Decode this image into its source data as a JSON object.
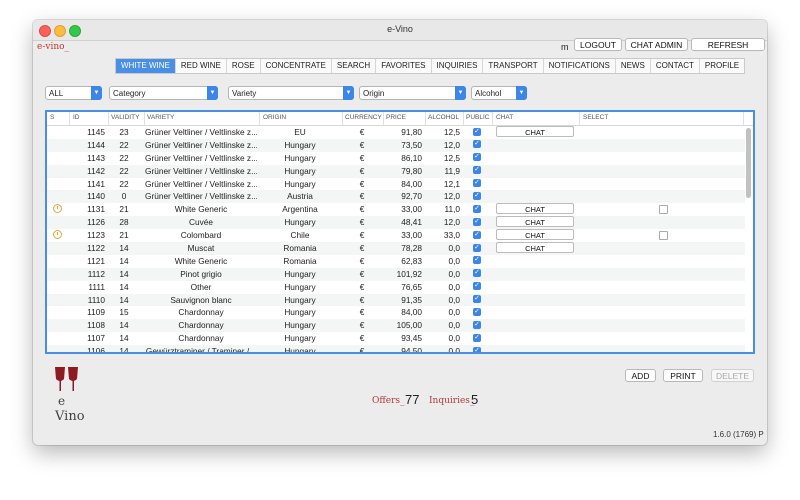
{
  "window": {
    "title": "e-Vino"
  },
  "brand": "e-vino_",
  "user": {
    "name": "m"
  },
  "header_buttons": {
    "logout": "LOGOUT",
    "chat_admin": "CHAT ADMIN",
    "refresh": "REFRESH"
  },
  "nav": [
    "WHITE WINE",
    "RED WINE",
    "ROSE",
    "CONCENTRATE",
    "SEARCH",
    "FAVORITES",
    "INQUIRIES",
    "TRANSPORT",
    "NOTIFICATIONS",
    "NEWS",
    "CONTACT",
    "PROFILE"
  ],
  "nav_active": "WHITE WINE",
  "filters": {
    "all": "ALL",
    "category": "Category",
    "variety": "Variety",
    "origin": "Origin",
    "alcohol": "Alcohol"
  },
  "columns": {
    "s": "S",
    "id": "ID",
    "validity": "VALIDITY",
    "variety": "VARIETY",
    "origin": "ORIGIN",
    "currency": "CURRENCY",
    "price": "PRICE",
    "alcohol": "ALCOHOL",
    "public": "PUBLIC",
    "chat": "CHAT",
    "select": "SELECT"
  },
  "chat_label": "CHAT",
  "rows": [
    {
      "id": "1145",
      "validity": "23",
      "variety": "Grüner Veltliner / Veltlinske z...",
      "origin": "EU",
      "currency": "€",
      "price": "91,80",
      "alcohol": "12,5",
      "public": true,
      "chat": true,
      "select": false,
      "clock": false
    },
    {
      "id": "1144",
      "validity": "22",
      "variety": "Grüner Veltliner / Veltlinske z...",
      "origin": "Hungary",
      "currency": "€",
      "price": "73,50",
      "alcohol": "12,0",
      "public": true,
      "chat": false,
      "select": false,
      "clock": false
    },
    {
      "id": "1143",
      "validity": "22",
      "variety": "Grüner Veltliner / Veltlinske z...",
      "origin": "Hungary",
      "currency": "€",
      "price": "86,10",
      "alcohol": "12,5",
      "public": true,
      "chat": false,
      "select": false,
      "clock": false
    },
    {
      "id": "1142",
      "validity": "22",
      "variety": "Grüner Veltliner / Veltlinske z...",
      "origin": "Hungary",
      "currency": "€",
      "price": "79,80",
      "alcohol": "11,9",
      "public": true,
      "chat": false,
      "select": false,
      "clock": false
    },
    {
      "id": "1141",
      "validity": "22",
      "variety": "Grüner Veltliner / Veltlinske z...",
      "origin": "Hungary",
      "currency": "€",
      "price": "84,00",
      "alcohol": "12,1",
      "public": true,
      "chat": false,
      "select": false,
      "clock": false
    },
    {
      "id": "1140",
      "validity": "0",
      "variety": "Grüner Veltliner / Veltlinske z...",
      "origin": "Austria",
      "currency": "€",
      "price": "92,70",
      "alcohol": "12,0",
      "public": true,
      "chat": false,
      "select": false,
      "clock": false
    },
    {
      "id": "1131",
      "validity": "21",
      "variety": "White Generic",
      "origin": "Argentina",
      "currency": "€",
      "price": "33,00",
      "alcohol": "11,0",
      "public": true,
      "chat": true,
      "select": true,
      "clock": true
    },
    {
      "id": "1126",
      "validity": "28",
      "variety": "Cuvée",
      "origin": "Hungary",
      "currency": "€",
      "price": "48,41",
      "alcohol": "12,0",
      "public": true,
      "chat": true,
      "select": false,
      "clock": false
    },
    {
      "id": "1123",
      "validity": "21",
      "variety": "Colombard",
      "origin": "Chile",
      "currency": "€",
      "price": "33,00",
      "alcohol": "33,0",
      "public": true,
      "chat": true,
      "select": true,
      "clock": true
    },
    {
      "id": "1122",
      "validity": "14",
      "variety": "Muscat",
      "origin": "Romania",
      "currency": "€",
      "price": "78,28",
      "alcohol": "0,0",
      "public": true,
      "chat": true,
      "select": false,
      "clock": false
    },
    {
      "id": "1121",
      "validity": "14",
      "variety": "White Generic",
      "origin": "Romania",
      "currency": "€",
      "price": "62,83",
      "alcohol": "0,0",
      "public": true,
      "chat": false,
      "select": false,
      "clock": false
    },
    {
      "id": "1112",
      "validity": "14",
      "variety": "Pinot grigio",
      "origin": "Hungary",
      "currency": "€",
      "price": "101,92",
      "alcohol": "0,0",
      "public": true,
      "chat": false,
      "select": false,
      "clock": false
    },
    {
      "id": "1111",
      "validity": "14",
      "variety": "Other",
      "origin": "Hungary",
      "currency": "€",
      "price": "76,65",
      "alcohol": "0,0",
      "public": true,
      "chat": false,
      "select": false,
      "clock": false
    },
    {
      "id": "1110",
      "validity": "14",
      "variety": "Sauvignon blanc",
      "origin": "Hungary",
      "currency": "€",
      "price": "91,35",
      "alcohol": "0,0",
      "public": true,
      "chat": false,
      "select": false,
      "clock": false
    },
    {
      "id": "1109",
      "validity": "15",
      "variety": "Chardonnay",
      "origin": "Hungary",
      "currency": "€",
      "price": "84,00",
      "alcohol": "0,0",
      "public": true,
      "chat": false,
      "select": false,
      "clock": false
    },
    {
      "id": "1108",
      "validity": "14",
      "variety": "Chardonnay",
      "origin": "Hungary",
      "currency": "€",
      "price": "105,00",
      "alcohol": "0,0",
      "public": true,
      "chat": false,
      "select": false,
      "clock": false
    },
    {
      "id": "1107",
      "validity": "14",
      "variety": "Chardonnay",
      "origin": "Hungary",
      "currency": "€",
      "price": "93,45",
      "alcohol": "0,0",
      "public": true,
      "chat": false,
      "select": false,
      "clock": false
    },
    {
      "id": "1106",
      "validity": "14",
      "variety": "Gewürztraminer / Traminer /...",
      "origin": "Hungary",
      "currency": "€",
      "price": "94,50",
      "alcohol": "0,0",
      "public": true,
      "chat": false,
      "select": false,
      "clock": false
    }
  ],
  "actions": {
    "add": "ADD",
    "print": "PRINT",
    "delete": "DELETE"
  },
  "stats": {
    "offers_label": "Offers_",
    "offers": "77",
    "inquiries_label": "Inquiries_",
    "inquiries": "5"
  },
  "logo": {
    "text_e": "e",
    "text_vino": "Vino"
  },
  "version": "1.6.0 (1769) P",
  "colors": {
    "accent": "#4a8fe6",
    "brand": "#c0392b",
    "clock": "#e8a33c"
  }
}
